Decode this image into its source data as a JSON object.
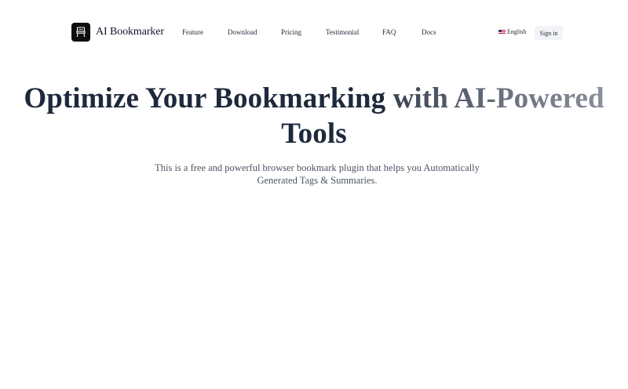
{
  "brand": {
    "name": "AI Bookmarker",
    "logo_icon": "bookmark-chair-icon"
  },
  "nav": {
    "items": [
      {
        "label": "Feature"
      },
      {
        "label": "Download"
      },
      {
        "label": "Pricing"
      },
      {
        "label": "Testimonial"
      },
      {
        "label": "FAQ"
      },
      {
        "label": "Docs"
      }
    ]
  },
  "language": {
    "label": "English",
    "flag_icon": "us-flag-icon"
  },
  "auth": {
    "signin_label": "Sign in"
  },
  "hero": {
    "title_main": "Optimize Your Bookmarking ",
    "title_accent": "with AI-Powered",
    "title_line2": "Tools",
    "subtitle": "This is a free and powerful browser bookmark plugin that helps you Automatically Generated Tags & Summaries."
  },
  "colors": {
    "text_dark": "#1e293b",
    "accent_gradient_start": "#3b4452",
    "accent_gradient_end": "#8a8f98",
    "signin_bg": "#f1f3f6",
    "logo_bg": "#0f0f0f"
  }
}
